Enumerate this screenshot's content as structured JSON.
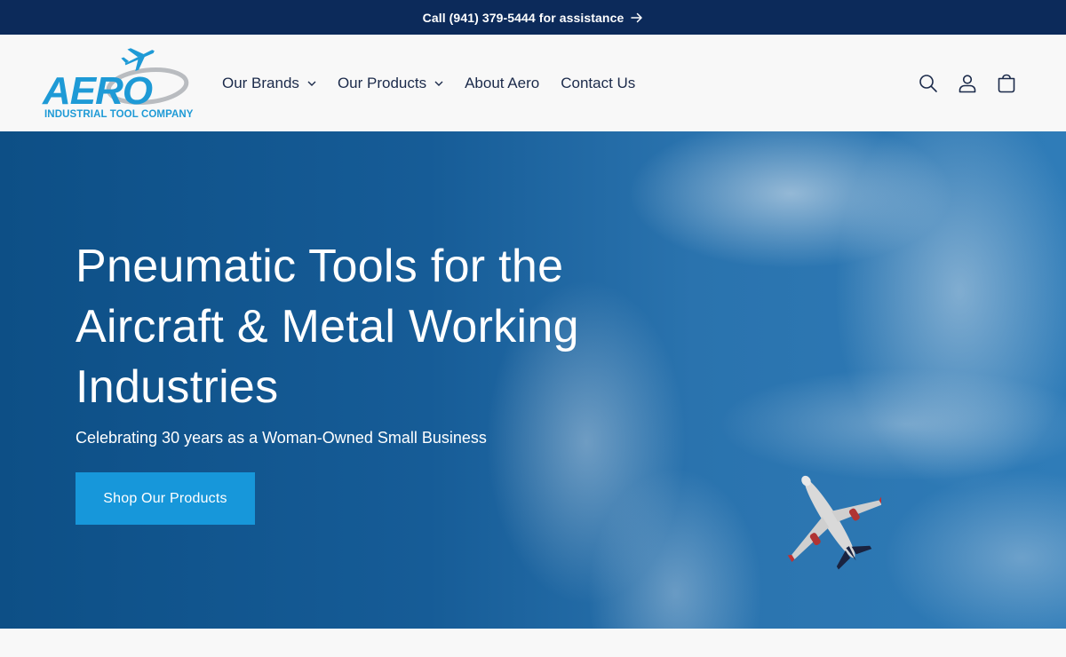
{
  "announcement": {
    "text": "Call (941) 379-5444 for assistance"
  },
  "logo": {
    "wordmark": "AERO",
    "tagline": "INDUSTRIAL TOOL COMPANY"
  },
  "nav": {
    "items": [
      {
        "label": "Our Brands",
        "dropdown": true
      },
      {
        "label": "Our Products",
        "dropdown": true
      },
      {
        "label": "About Aero",
        "dropdown": false
      },
      {
        "label": "Contact Us",
        "dropdown": false
      }
    ]
  },
  "header_icons": [
    "search-icon",
    "account-icon",
    "cart-icon"
  ],
  "hero": {
    "title": "Pneumatic Tools for the Aircraft & Metal Working Industries",
    "subtitle": "Celebrating 30 years as a Woman-Owned Small Business",
    "cta_label": "Shop Our Products"
  },
  "colors": {
    "announcement_bg": "#0c2a5a",
    "brand_blue": "#1e9ad6",
    "cta_bg": "#1797da",
    "nav_text": "#1b2a4a"
  }
}
